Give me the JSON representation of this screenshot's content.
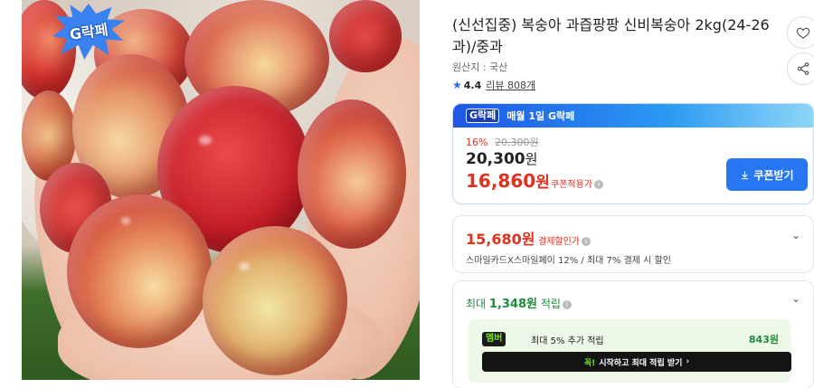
{
  "badge": {
    "text": "G락페"
  },
  "product": {
    "title": "(신선집중) 복숭아 과즙팡팡 신비복숭아 2kg(24-26과)/중과",
    "origin": "원산지 : 국산",
    "rating": "4.4",
    "reviews": "리뷰 808개"
  },
  "promo": {
    "logo": "G락페",
    "banner": "매월 1일 G락페",
    "discount_pct": "16%",
    "original_price": "20,300원",
    "price_number": "20,300",
    "price_unit": "원",
    "coupon_price_number": "16,860",
    "coupon_price_unit": "원",
    "coupon_label": "쿠폰적용가",
    "coupon_button": "쿠폰받기"
  },
  "card": {
    "price_number": "15,680",
    "price_unit": "원",
    "label": "결제할인가",
    "detail": "스마일카드X스마일페이 12% / 최대 7% 결제 시 할인"
  },
  "points": {
    "prefix": "최대 ",
    "amount": "1,348원",
    "suffix": " 적립",
    "member_badge": "멤버",
    "member_text": "최대 5% 추가 적립",
    "member_points": "843원",
    "member_button": "시작하고 최대 적립 받기"
  },
  "icons": {
    "heart": "heart-icon",
    "share": "share-icon",
    "star": "star-icon",
    "download": "download-icon",
    "chevron": "chevron-down-icon"
  },
  "colors": {
    "accent_blue": "#2877f2",
    "price_red": "#e0301e",
    "point_green": "#1f8a3b"
  }
}
